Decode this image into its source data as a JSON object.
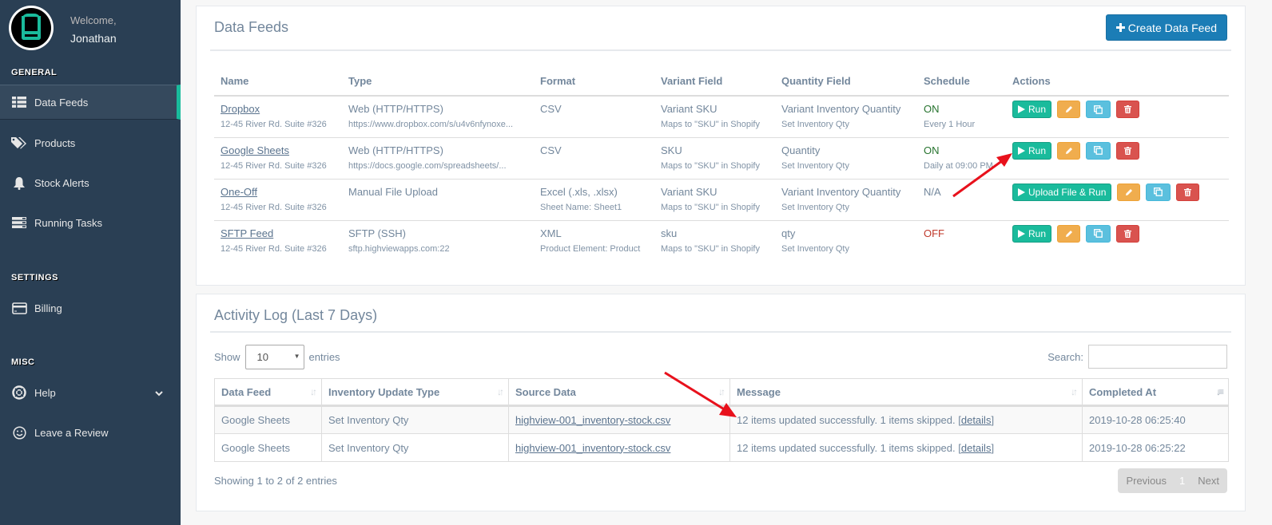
{
  "sidebar": {
    "welcome": "Welcome,",
    "username": "Jonathan",
    "sections": {
      "general": "GENERAL",
      "settings": "SETTINGS",
      "misc": "MISC"
    },
    "items": {
      "data_feeds": {
        "label": "Data Feeds",
        "icon": "list-icon"
      },
      "products": {
        "label": "Products",
        "icon": "tags-icon"
      },
      "stock_alerts": {
        "label": "Stock Alerts",
        "icon": "bell-icon"
      },
      "running_tasks": {
        "label": "Running Tasks",
        "icon": "server-icon"
      },
      "billing": {
        "label": "Billing",
        "icon": "credit-card-icon"
      },
      "help": {
        "label": "Help",
        "icon": "life-ring-icon"
      },
      "review": {
        "label": "Leave a Review",
        "icon": "smile-icon"
      }
    }
  },
  "feeds": {
    "title": "Data Feeds",
    "create_label": "Create Data Feed",
    "columns": [
      "Name",
      "Type",
      "Format",
      "Variant Field",
      "Quantity Field",
      "Schedule",
      "Actions"
    ],
    "rows": [
      {
        "name": "Dropbox",
        "address": "12-45 River Rd. Suite #326",
        "type": "Web (HTTP/HTTPS)",
        "type_sub": "https://www.dropbox.com/s/u4v6nfynoxe...",
        "format": "CSV",
        "format_sub": "",
        "variant": "Variant SKU",
        "variant_sub": "Maps to \"SKU\" in Shopify",
        "quantity": "Variant Inventory Quantity",
        "quantity_sub": "Set Inventory Qty",
        "schedule": "ON",
        "schedule_sub": "Every 1 Hour",
        "run_label": "Run"
      },
      {
        "name": "Google Sheets",
        "address": "12-45 River Rd. Suite #326",
        "type": "Web (HTTP/HTTPS)",
        "type_sub": "https://docs.google.com/spreadsheets/...",
        "format": "CSV",
        "format_sub": "",
        "variant": "SKU",
        "variant_sub": "Maps to \"SKU\" in Shopify",
        "quantity": "Quantity",
        "quantity_sub": "Set Inventory Qty",
        "schedule": "ON",
        "schedule_sub": "Daily at 09:00 PM",
        "run_label": "Run"
      },
      {
        "name": "One-Off",
        "address": "12-45 River Rd. Suite #326",
        "type": "Manual File Upload",
        "type_sub": "",
        "format": "Excel (.xls, .xlsx)",
        "format_sub": "Sheet Name: Sheet1",
        "variant": "Variant SKU",
        "variant_sub": "Maps to \"SKU\" in Shopify",
        "quantity": "Variant Inventory Quantity",
        "quantity_sub": "Set Inventory Qty",
        "schedule": "N/A",
        "schedule_sub": "",
        "run_label": "Upload File & Run"
      },
      {
        "name": "SFTP Feed",
        "address": "12-45 River Rd. Suite #326",
        "type": "SFTP (SSH)",
        "type_sub": "sftp.highviewapps.com:22",
        "format": "XML",
        "format_sub": "Product Element: Product",
        "variant": "sku",
        "variant_sub": "Maps to \"SKU\" in Shopify",
        "quantity": "qty",
        "quantity_sub": "Set Inventory Qty",
        "schedule": "OFF",
        "schedule_sub": "",
        "run_label": "Run"
      }
    ]
  },
  "log": {
    "title": "Activity Log (Last 7 Days)",
    "show_label": "Show",
    "entries_label": "entries",
    "page_size": "10",
    "search_label": "Search:",
    "search_value": "",
    "columns": [
      "Data Feed",
      "Inventory Update Type",
      "Source Data",
      "Message",
      "Completed At"
    ],
    "rows": [
      {
        "feed": "Google Sheets",
        "update_type": "Set Inventory Qty",
        "source": "highview-001_inventory-stock.csv",
        "message": "12 items updated successfully. 1 items skipped. ",
        "details": "details",
        "completed": "2019-10-28 06:25:40"
      },
      {
        "feed": "Google Sheets",
        "update_type": "Set Inventory Qty",
        "source": "highview-001_inventory-stock.csv",
        "message": "12 items updated successfully. 1 items skipped. ",
        "details": "details",
        "completed": "2019-10-28 06:25:22"
      }
    ],
    "showing": "Showing 1 to 2 of 2 entries",
    "pager": {
      "previous": "Previous",
      "current": "1",
      "next": "Next"
    }
  },
  "colors": {
    "sidebar_bg": "#2a3f54",
    "accent": "#1abb9c",
    "primary": "#1b7db6",
    "warning": "#f0ad4e",
    "info": "#5bc0de",
    "danger": "#d9534f",
    "annotation_arrow": "#e8111c"
  }
}
